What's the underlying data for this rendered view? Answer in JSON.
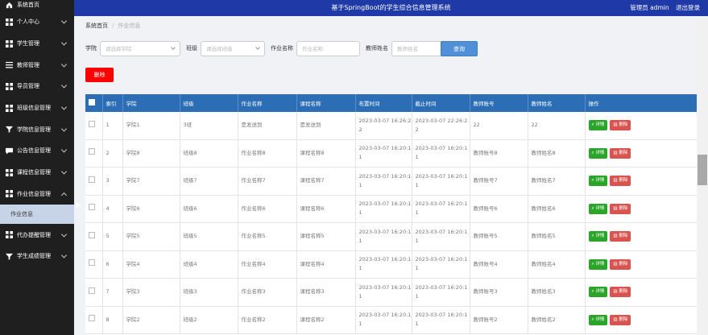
{
  "app": {
    "title": "基于SpringBoot的学生综合信息管理系统",
    "user_label": "管理员 admin",
    "logout_label": "退出登录"
  },
  "sidebar": {
    "items": [
      {
        "label": "系统首页",
        "icon": "home-icon",
        "expandable": false
      },
      {
        "label": "个人中心",
        "icon": "grid-icon",
        "expandable": true
      },
      {
        "label": "学生管理",
        "icon": "grid-icon",
        "expandable": true
      },
      {
        "label": "教师管理",
        "icon": "sliders-icon",
        "expandable": true
      },
      {
        "label": "导员管理",
        "icon": "grid-icon",
        "expandable": true
      },
      {
        "label": "班级信息管理",
        "icon": "grid-icon",
        "expandable": true
      },
      {
        "label": "学院信息管理",
        "icon": "funnel-icon",
        "expandable": true
      },
      {
        "label": "公告信息管理",
        "icon": "chat-icon",
        "expandable": true
      },
      {
        "label": "课程信息管理",
        "icon": "grid-icon",
        "expandable": true
      },
      {
        "label": "作业信息管理",
        "icon": "grid-icon",
        "expandable": true,
        "expanded": true
      },
      {
        "label": "代办提醒管理",
        "icon": "grid-icon",
        "expandable": true
      },
      {
        "label": "学生成绩管理",
        "icon": "funnel-icon",
        "expandable": true
      }
    ],
    "subitem": "作业信息"
  },
  "breadcrumb": {
    "home": "系统首页",
    "current": "作业信息"
  },
  "filters": {
    "college_label": "学院",
    "college_placeholder": "请选择学院",
    "class_label": "班级",
    "class_placeholder": "请选择班级",
    "homework_label": "作业名称",
    "homework_placeholder": "作业名称",
    "teacher_label": "教师姓名",
    "teacher_placeholder": "教师姓名",
    "search_button": "查询"
  },
  "delete_button": "删除",
  "table": {
    "headers": [
      "索引",
      "学院",
      "班级",
      "作业名称",
      "课程名称",
      "布置时间",
      "截止时间",
      "教师账号",
      "教师姓名",
      "操作"
    ],
    "view_label": "详情",
    "delete_label": "删除",
    "rows": [
      {
        "index": "1",
        "college": "学院1",
        "class": "3班",
        "homework": "是发送到",
        "course": "是发送到",
        "assigned": "2023-03-07 16:26:2 2",
        "deadline": "2023-03-07 22:26:2 2",
        "teacher_account": "22",
        "teacher_name": "22"
      },
      {
        "index": "2",
        "college": "学院8",
        "class": "班级8",
        "homework": "作业名称8",
        "course": "课程名称8",
        "assigned": "2023-03-07 16:20:1 1",
        "deadline": "2023-03-07 16:20:1 1",
        "teacher_account": "教师账号8",
        "teacher_name": "教师姓名8"
      },
      {
        "index": "3",
        "college": "学院7",
        "class": "班级7",
        "homework": "作业名称7",
        "course": "课程名称7",
        "assigned": "2023-03-07 16:20:1 1",
        "deadline": "2023-03-07 16:20:1 1",
        "teacher_account": "教师账号7",
        "teacher_name": "教师姓名7"
      },
      {
        "index": "4",
        "college": "学院6",
        "class": "班级6",
        "homework": "作业名称6",
        "course": "课程名称6",
        "assigned": "2023-03-07 16:20:1 1",
        "deadline": "2023-03-07 16:20:1 1",
        "teacher_account": "教师账号6",
        "teacher_name": "教师姓名6"
      },
      {
        "index": "5",
        "college": "学院5",
        "class": "班级5",
        "homework": "作业名称5",
        "course": "课程名称5",
        "assigned": "2023-03-07 16:20:1 1",
        "deadline": "2023-03-07 16:20:1 1",
        "teacher_account": "教师账号5",
        "teacher_name": "教师姓名5"
      },
      {
        "index": "6",
        "college": "学院4",
        "class": "班级4",
        "homework": "作业名称4",
        "course": "课程名称4",
        "assigned": "2023-03-07 16:20:1 1",
        "deadline": "2023-03-07 16:20:1 1",
        "teacher_account": "教师账号4",
        "teacher_name": "教师姓名4"
      },
      {
        "index": "7",
        "college": "学院3",
        "class": "班级3",
        "homework": "作业名称3",
        "course": "课程名称3",
        "assigned": "2023-03-07 16:20:1 1",
        "deadline": "2023-03-07 16:20:1 1",
        "teacher_account": "教师账号3",
        "teacher_name": "教师姓名3"
      },
      {
        "index": "8",
        "college": "学院2",
        "class": "班级2",
        "homework": "作业名称2",
        "course": "课程名称2",
        "assigned": "2023-03-07 16:20:1 1",
        "deadline": "2023-03-07 16:20:1 1",
        "teacher_account": "教师账号2",
        "teacher_name": "教师姓名2"
      }
    ]
  },
  "colors": {
    "topbar": "#1f3aa6",
    "sidebar": "#1f1f1f",
    "table_header": "#2c6eb5",
    "view": "#2aa52a",
    "delete": "#d9534f",
    "danger": "#ff0000"
  }
}
